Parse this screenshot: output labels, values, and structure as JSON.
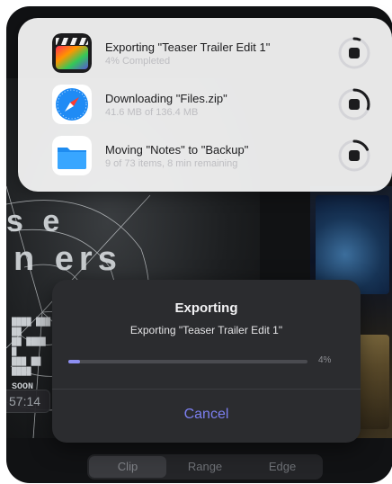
{
  "background_app": {
    "word_line_1": "s e",
    "word_line_2": "n ers",
    "strip_text": "SOON",
    "timecode": "57:14",
    "segmented": [
      "Clip",
      "Range",
      "Edge"
    ],
    "segmented_selected": "Clip"
  },
  "progress_list": [
    {
      "icon": "final-cut-pro-icon",
      "title": "Exporting \"Teaser Trailer Edit 1\"",
      "subtitle": "4% Completed",
      "progress": 0.04
    },
    {
      "icon": "safari-icon",
      "title": "Downloading \"Files.zip\"",
      "subtitle": "41.6 MB of 136.4 MB",
      "progress": 0.3
    },
    {
      "icon": "files-folder-icon",
      "title": "Moving \"Notes\" to \"Backup\"",
      "subtitle": "9 of 73 items, 8 min remaining",
      "progress": 0.18
    }
  ],
  "dialog": {
    "title": "Exporting",
    "subtitle": "Exporting \"Teaser Trailer Edit 1\"",
    "percent_label": "4%",
    "progress": 0.04,
    "cancel_label": "Cancel"
  },
  "colors": {
    "accent": "#7c7ff0",
    "progress_fill": "#8d8ff2",
    "dialog_bg": "#2b2c2f"
  }
}
